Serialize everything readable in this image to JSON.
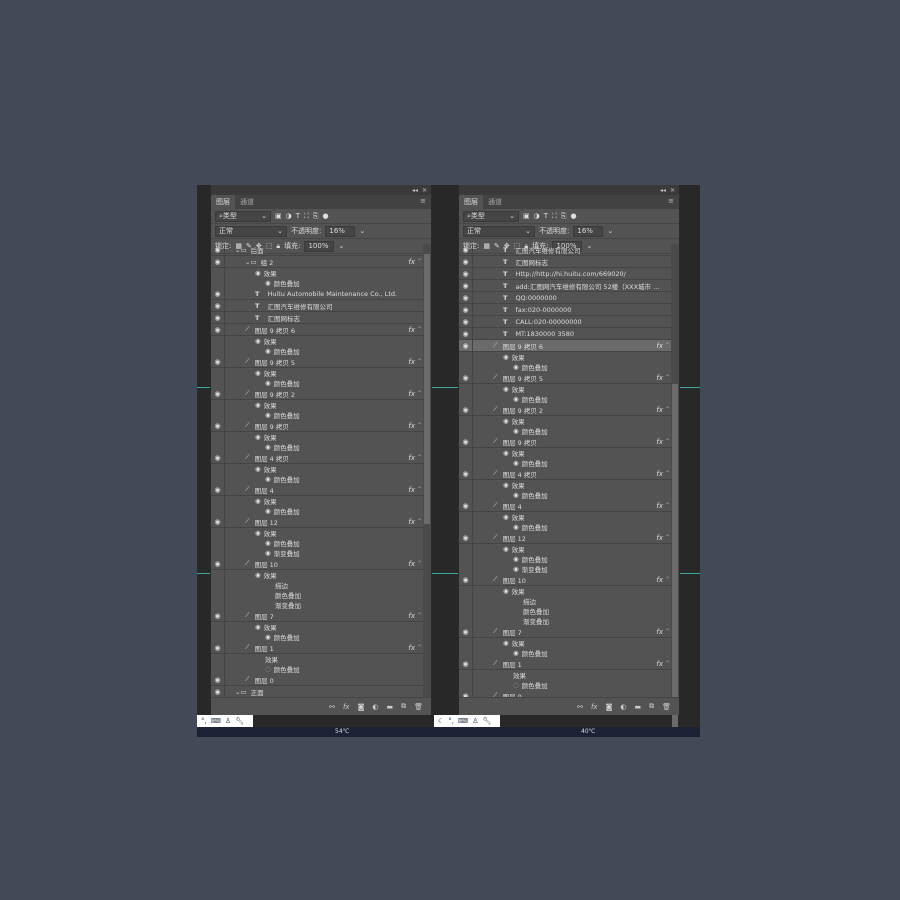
{
  "tabs": [
    "图层",
    "通道"
  ],
  "filter_label": "类型",
  "blend_mode": "正常",
  "opacity_label": "不透明度:",
  "opacity_value": "16%",
  "lock_label": "锁定:",
  "fill_label": "填充:",
  "fill_value": "100%",
  "left_layers": [
    {
      "type": "group",
      "name": "后面",
      "indent": 1
    },
    {
      "type": "group",
      "name": "组 2",
      "indent": 2,
      "fx": true
    },
    {
      "type": "effect",
      "name": "效果",
      "indent": 3,
      "eye": true
    },
    {
      "type": "effect",
      "name": "颜色叠加",
      "indent": 4,
      "eye": true
    },
    {
      "type": "text",
      "name": "Huitu Automobile Maintenance Co., Ltd.",
      "indent": 3
    },
    {
      "type": "text",
      "name": "汇图汽车维修有限公司",
      "indent": 3
    },
    {
      "type": "text",
      "name": "汇图网标志",
      "indent": 3
    },
    {
      "type": "pixel",
      "name": "图层 9 拷贝 6",
      "indent": 2,
      "fx": true
    },
    {
      "type": "effect",
      "name": "效果",
      "indent": 3,
      "eye": true
    },
    {
      "type": "effect",
      "name": "颜色叠加",
      "indent": 4,
      "eye": true
    },
    {
      "type": "pixel",
      "name": "图层 9 拷贝 5",
      "indent": 2,
      "fx": true
    },
    {
      "type": "effect",
      "name": "效果",
      "indent": 3,
      "eye": true
    },
    {
      "type": "effect",
      "name": "颜色叠加",
      "indent": 4,
      "eye": true
    },
    {
      "type": "pixel",
      "name": "图层 9 拷贝 2",
      "indent": 2,
      "fx": true
    },
    {
      "type": "effect",
      "name": "效果",
      "indent": 3,
      "eye": true
    },
    {
      "type": "effect",
      "name": "颜色叠加",
      "indent": 4,
      "eye": true
    },
    {
      "type": "pixel",
      "name": "图层 9 拷贝",
      "indent": 2,
      "fx": true
    },
    {
      "type": "effect",
      "name": "效果",
      "indent": 3,
      "eye": true
    },
    {
      "type": "effect",
      "name": "颜色叠加",
      "indent": 4,
      "eye": true
    },
    {
      "type": "pixel",
      "name": "图层 4 拷贝",
      "indent": 2,
      "fx": true
    },
    {
      "type": "effect",
      "name": "效果",
      "indent": 3,
      "eye": true
    },
    {
      "type": "effect",
      "name": "颜色叠加",
      "indent": 4,
      "eye": true
    },
    {
      "type": "pixel",
      "name": "图层 4",
      "indent": 2,
      "fx": true
    },
    {
      "type": "effect",
      "name": "效果",
      "indent": 3,
      "eye": true
    },
    {
      "type": "effect",
      "name": "颜色叠加",
      "indent": 4,
      "eye": true
    },
    {
      "type": "pixel",
      "name": "图层 12",
      "indent": 2,
      "fx": true
    },
    {
      "type": "effect",
      "name": "效果",
      "indent": 3,
      "eye": true
    },
    {
      "type": "effect",
      "name": "颜色叠加",
      "indent": 4,
      "eye": true
    },
    {
      "type": "effect",
      "name": "渐变叠加",
      "indent": 4,
      "eye": true
    },
    {
      "type": "pixel",
      "name": "图层 10",
      "indent": 2,
      "fx": true
    },
    {
      "type": "effect",
      "name": "效果",
      "indent": 3,
      "eye": true
    },
    {
      "type": "effect",
      "name": "描边",
      "indent": 4,
      "eye": false
    },
    {
      "type": "effect",
      "name": "颜色叠加",
      "indent": 4,
      "eye": false
    },
    {
      "type": "effect",
      "name": "渐变叠加",
      "indent": 4,
      "eye": false
    },
    {
      "type": "pixel",
      "name": "图层 7",
      "indent": 2,
      "fx": true
    },
    {
      "type": "effect",
      "name": "效果",
      "indent": 3,
      "eye": true
    },
    {
      "type": "effect",
      "name": "颜色叠加",
      "indent": 4,
      "eye": true
    },
    {
      "type": "pixel",
      "name": "图层 1",
      "indent": 2,
      "fx": true
    },
    {
      "type": "effect",
      "name": "效果",
      "indent": 3,
      "eye": false
    },
    {
      "type": "effect",
      "name": "颜色叠加",
      "indent": 4,
      "eye": "dim"
    },
    {
      "type": "pixel",
      "name": "图层 0",
      "indent": 2
    },
    {
      "type": "group",
      "name": "正面",
      "indent": 1
    }
  ],
  "right_layers": [
    {
      "type": "text",
      "name": "汇图汽车维修有限公司",
      "indent": 3
    },
    {
      "type": "text",
      "name": "汇图网标志",
      "indent": 3
    },
    {
      "type": "text",
      "name": "Http://http://hi.huitu.com/669020/",
      "indent": 3
    },
    {
      "type": "text",
      "name": "add:汇图网汽车维修有限公司 52楼（XXX城市 ...",
      "indent": 3
    },
    {
      "type": "text",
      "name": "QQ:0000000",
      "indent": 3
    },
    {
      "type": "text",
      "name": "fax:020-0000000",
      "indent": 3
    },
    {
      "type": "text",
      "name": "CALL:020-00000000",
      "indent": 3
    },
    {
      "type": "text",
      "name": "MT:1830000 3580",
      "indent": 3
    },
    {
      "type": "pixel",
      "name": "图层 9 拷贝 6",
      "indent": 2,
      "fx": true,
      "selected": true
    },
    {
      "type": "effect",
      "name": "效果",
      "indent": 3,
      "eye": true
    },
    {
      "type": "effect",
      "name": "颜色叠加",
      "indent": 4,
      "eye": true
    },
    {
      "type": "pixel",
      "name": "图层 9 拷贝 5",
      "indent": 2,
      "fx": true
    },
    {
      "type": "effect",
      "name": "效果",
      "indent": 3,
      "eye": true
    },
    {
      "type": "effect",
      "name": "颜色叠加",
      "indent": 4,
      "eye": true
    },
    {
      "type": "pixel",
      "name": "图层 9 拷贝 2",
      "indent": 2,
      "fx": true
    },
    {
      "type": "effect",
      "name": "效果",
      "indent": 3,
      "eye": true
    },
    {
      "type": "effect",
      "name": "颜色叠加",
      "indent": 4,
      "eye": true
    },
    {
      "type": "pixel",
      "name": "图层 9 拷贝",
      "indent": 2,
      "fx": true
    },
    {
      "type": "effect",
      "name": "效果",
      "indent": 3,
      "eye": true
    },
    {
      "type": "effect",
      "name": "颜色叠加",
      "indent": 4,
      "eye": true
    },
    {
      "type": "pixel",
      "name": "图层 4 拷贝",
      "indent": 2,
      "fx": true
    },
    {
      "type": "effect",
      "name": "效果",
      "indent": 3,
      "eye": true
    },
    {
      "type": "effect",
      "name": "颜色叠加",
      "indent": 4,
      "eye": true
    },
    {
      "type": "pixel",
      "name": "图层 4",
      "indent": 2,
      "fx": true
    },
    {
      "type": "effect",
      "name": "效果",
      "indent": 3,
      "eye": true
    },
    {
      "type": "effect",
      "name": "颜色叠加",
      "indent": 4,
      "eye": true
    },
    {
      "type": "pixel",
      "name": "图层 12",
      "indent": 2,
      "fx": true
    },
    {
      "type": "effect",
      "name": "效果",
      "indent": 3,
      "eye": true
    },
    {
      "type": "effect",
      "name": "颜色叠加",
      "indent": 4,
      "eye": true
    },
    {
      "type": "effect",
      "name": "渐变叠加",
      "indent": 4,
      "eye": true
    },
    {
      "type": "pixel",
      "name": "图层 10",
      "indent": 2,
      "fx": true
    },
    {
      "type": "effect",
      "name": "效果",
      "indent": 3,
      "eye": true
    },
    {
      "type": "effect",
      "name": "描边",
      "indent": 4,
      "eye": false
    },
    {
      "type": "effect",
      "name": "颜色叠加",
      "indent": 4,
      "eye": false
    },
    {
      "type": "effect",
      "name": "渐变叠加",
      "indent": 4,
      "eye": false
    },
    {
      "type": "pixel",
      "name": "图层 7",
      "indent": 2,
      "fx": true
    },
    {
      "type": "effect",
      "name": "效果",
      "indent": 3,
      "eye": true
    },
    {
      "type": "effect",
      "name": "颜色叠加",
      "indent": 4,
      "eye": true
    },
    {
      "type": "pixel",
      "name": "图层 1",
      "indent": 2,
      "fx": true
    },
    {
      "type": "effect",
      "name": "效果",
      "indent": 3,
      "eye": false
    },
    {
      "type": "effect",
      "name": "颜色叠加",
      "indent": 4,
      "eye": "dim"
    },
    {
      "type": "pixel",
      "name": "图层 0",
      "indent": 2
    }
  ],
  "taskbar": {
    "left_temp": "54℃",
    "right_temp": "40℃"
  },
  "colors": {
    "panel": "#535353",
    "background": "#434a57",
    "guide": "#3aa8a0"
  }
}
